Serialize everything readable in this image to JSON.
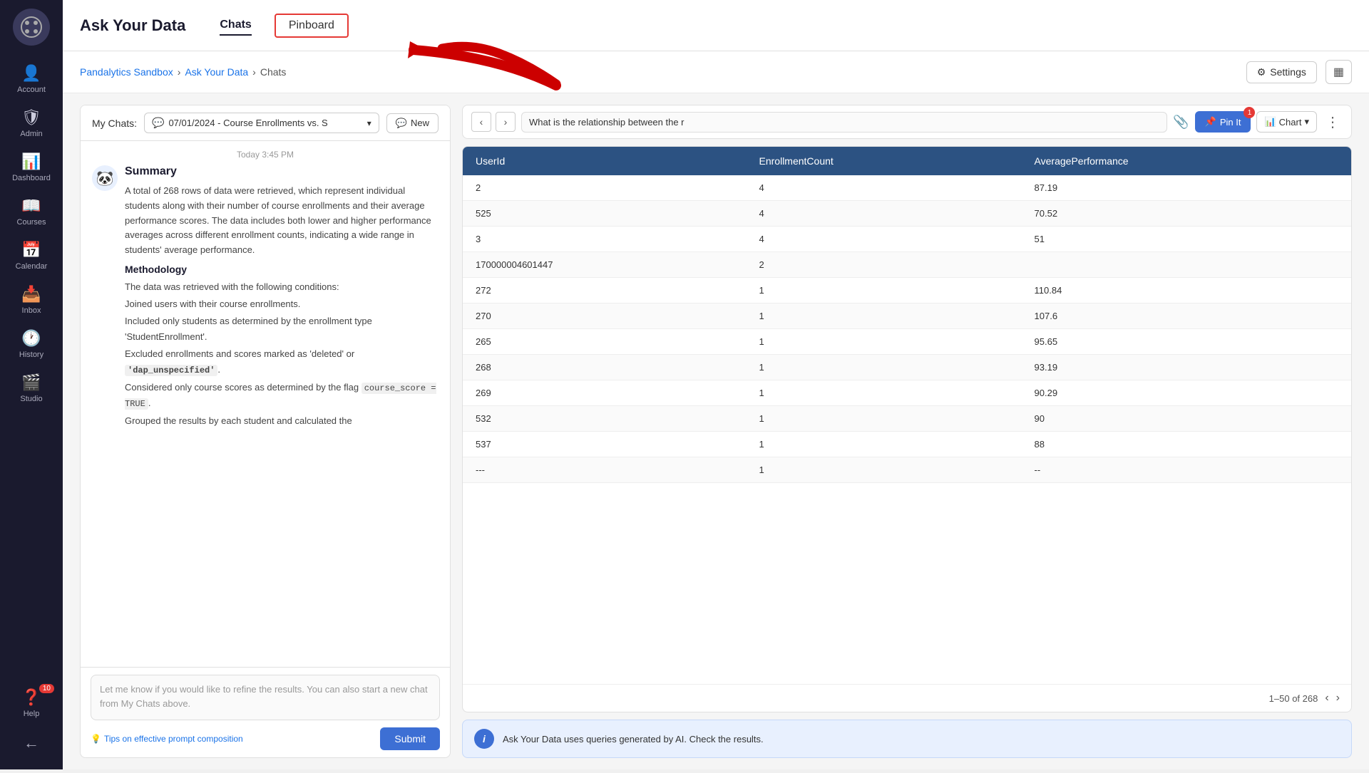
{
  "sidebar": {
    "logo_icon": "⚙",
    "items": [
      {
        "id": "account",
        "icon": "👤",
        "label": "Account",
        "active": false
      },
      {
        "id": "admin",
        "icon": "🛡",
        "label": "Admin",
        "active": false
      },
      {
        "id": "dashboard",
        "icon": "📊",
        "label": "Dashboard",
        "active": false
      },
      {
        "id": "courses",
        "icon": "📖",
        "label": "Courses",
        "active": false
      },
      {
        "id": "calendar",
        "icon": "📅",
        "label": "Calendar",
        "active": false
      },
      {
        "id": "inbox",
        "icon": "📥",
        "label": "Inbox",
        "active": false
      },
      {
        "id": "history",
        "icon": "🕐",
        "label": "History",
        "active": false
      },
      {
        "id": "studio",
        "icon": "🎬",
        "label": "Studio",
        "active": false
      },
      {
        "id": "help",
        "icon": "❓",
        "label": "Help",
        "active": false,
        "badge": "10"
      }
    ],
    "back_icon": "←"
  },
  "topnav": {
    "title": "Ask Your Data",
    "tabs": [
      {
        "id": "chats",
        "label": "Chats",
        "active": true
      },
      {
        "id": "pinboard",
        "label": "Pinboard",
        "active": false,
        "highlighted": true
      }
    ]
  },
  "breadcrumb": {
    "items": [
      {
        "label": "Pandalytics Sandbox",
        "link": true
      },
      {
        "label": "Ask Your Data",
        "link": true
      },
      {
        "label": "Chats",
        "link": false
      }
    ],
    "settings_label": "Settings",
    "grid_icon": "▦"
  },
  "chat_panel": {
    "my_chats_label": "My Chats:",
    "chat_selector_value": "07/01/2024 - Course Enrollments vs. S",
    "new_button": "New",
    "chat_time": "Today 3:45 PM",
    "bot_icon": "🐼",
    "summary_heading": "Summary",
    "summary_text": "A total of 268 rows of data were retrieved, which represent individual students along with their number of course enrollments and their average performance scores. The data includes both lower and higher performance averages across different enrollment counts, indicating a wide range in students' average performance.",
    "methodology_heading": "Methodology",
    "methodology_items": [
      "The data was retrieved with the following conditions:",
      "Joined users with their course enrollments.",
      "Included only students as determined by the enrollment type 'StudentEnrollment'.",
      "Excluded enrollments and scores marked as 'deleted' or 'dap_unspecified'.",
      "Considered only course scores as determined by the flag course_score = TRUE.",
      "Grouped the results by each student and calculated the"
    ],
    "input_placeholder": "Let me know if you would like to refine the results.  You can also start a new chat from My Chats above.",
    "tips_label": "Tips on effective prompt composition",
    "submit_label": "Submit"
  },
  "query_bar": {
    "query_text": "What is the relationship between the r",
    "pin_label": "Pin It",
    "pin_badge": "1",
    "chart_label": "Chart",
    "more_icon": "⋮"
  },
  "data_table": {
    "columns": [
      "UserId",
      "EnrollmentCount",
      "AveragePerformance"
    ],
    "rows": [
      {
        "userid": "2",
        "enrollment": "4",
        "performance": "87.19"
      },
      {
        "userid": "525",
        "enrollment": "4",
        "performance": "70.52"
      },
      {
        "userid": "3",
        "enrollment": "4",
        "performance": "51"
      },
      {
        "userid": "170000004601447",
        "enrollment": "2",
        "performance": ""
      },
      {
        "userid": "272",
        "enrollment": "1",
        "performance": "110.84"
      },
      {
        "userid": "270",
        "enrollment": "1",
        "performance": "107.6"
      },
      {
        "userid": "265",
        "enrollment": "1",
        "performance": "95.65"
      },
      {
        "userid": "268",
        "enrollment": "1",
        "performance": "93.19"
      },
      {
        "userid": "269",
        "enrollment": "1",
        "performance": "90.29"
      },
      {
        "userid": "532",
        "enrollment": "1",
        "performance": "90"
      },
      {
        "userid": "537",
        "enrollment": "1",
        "performance": "88"
      },
      {
        "userid": "---",
        "enrollment": "1",
        "performance": "--"
      }
    ],
    "pagination_text": "1–50 of 268"
  },
  "info_bar": {
    "icon": "i",
    "text": "Ask Your Data uses queries generated by AI. Check the results."
  },
  "colors": {
    "sidebar_bg": "#1a1a2e",
    "table_header_bg": "#2c5282",
    "pin_btn_bg": "#3d6fd4",
    "pinboard_border": "#e53935"
  }
}
